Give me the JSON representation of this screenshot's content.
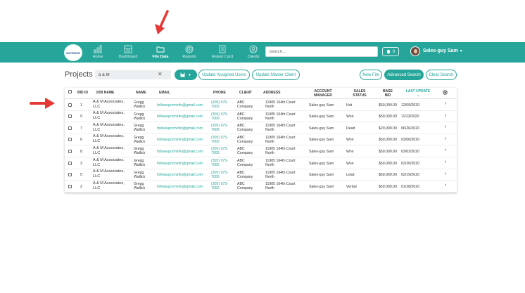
{
  "nav": {
    "logo_text": "SUPERIOR",
    "items": [
      {
        "label": "Home",
        "icon": "chart-bar-icon"
      },
      {
        "label": "Dashboard",
        "icon": "dashboard-icon"
      },
      {
        "label": "File Data",
        "icon": "folder-icon",
        "active": true
      },
      {
        "label": "Reports",
        "icon": "target-icon"
      },
      {
        "label": "Report Card",
        "icon": "card-icon"
      },
      {
        "label": "Clients",
        "icon": "clients-icon"
      }
    ],
    "search_placeholder": "Search...",
    "notification_count": "0",
    "user_name": "Sales-guy Sam"
  },
  "toolbar": {
    "title": "Projects",
    "filter_value": "a & M",
    "clear_symbol": "✕",
    "update_assigned_users": "Update Assigned Users",
    "update_master_client": "Update Master Client",
    "new_file": "New File",
    "advanced_search": "Advanced Search",
    "clear_search": "Clear Search"
  },
  "table": {
    "headers": {
      "bid_id": "BID ID",
      "job_name": "JOB NAME",
      "name": "NAME",
      "email": "EMAIL",
      "phone": "PHONE",
      "client": "CLIENT",
      "address": "ADDRESS",
      "account_manager_1": "ACCOUNT",
      "account_manager_2": "MANAGER",
      "sales_status_1": "SALES",
      "sales_status_2": "STATUS",
      "base_bid_1": "BASE",
      "base_bid_2": "BID",
      "last_update_1": "LAST UPDATE"
    },
    "rows": [
      {
        "bid_id": "1",
        "job_1": "A & M Associates,",
        "job_2": "LLC",
        "name_1": "Gregg",
        "name_2": "Wallick",
        "email": "followupcrminfo@gmail.com",
        "phone_1": "(305) 975-",
        "phone_2": "7000",
        "client_1": "ABC",
        "client_2": "Company",
        "addr_1": "11905 164th Court",
        "addr_2": "North",
        "manager": "Sales-guy Sam",
        "status": "Hot",
        "bid": "$50,000.00",
        "date": "12/09/2020"
      },
      {
        "bid_id": "9",
        "job_1": "A & M Associates,",
        "job_2": "LLC",
        "name_1": "Gregg",
        "name_2": "Wallick",
        "email": "followupcrminfo@gmail.com",
        "phone_1": "(305) 975-",
        "phone_2": "7000",
        "client_1": "ABC",
        "client_2": "Company",
        "addr_1": "11905 164th Court",
        "addr_2": "North",
        "manager": "Sales-guy Sam",
        "status": "Won",
        "bid": "$50,000.00",
        "date": "11/23/2020"
      },
      {
        "bid_id": "7",
        "job_1": "A & M Associates,",
        "job_2": "LLC",
        "name_1": "Gregg",
        "name_2": "Wallick",
        "email": "followupcrminfo@gmail.com",
        "phone_1": "(305) 975-",
        "phone_2": "7000",
        "client_1": "ABC",
        "client_2": "Company",
        "addr_1": "11905 164th Court",
        "addr_2": "North",
        "manager": "Sales-guy Sam",
        "status": "Dead",
        "bid": "$20,000.00",
        "date": "06/26/2020"
      },
      {
        "bid_id": "6",
        "job_1": "A & M Associates,",
        "job_2": "LLC",
        "name_1": "Gregg",
        "name_2": "Wallick",
        "email": "followupcrminfo@gmail.com",
        "phone_1": "(305) 975-",
        "phone_2": "7000",
        "client_1": "ABC",
        "client_2": "Company",
        "addr_1": "11905 164th Court",
        "addr_2": "North",
        "manager": "Sales-guy Sam",
        "status": "Won",
        "bid": "$50,000.00",
        "date": "03/06/2020"
      },
      {
        "bid_id": "8",
        "job_1": "A & M Associates,",
        "job_2": "LLC",
        "name_1": "Gregg",
        "name_2": "Wallick",
        "email": "followupcrminfo@gmail.com",
        "phone_1": "(305) 975-",
        "phone_2": "7000",
        "client_1": "ABC",
        "client_2": "Company",
        "addr_1": "11905 164th Court",
        "addr_2": "North",
        "manager": "Sales-guy Sam",
        "status": "Won",
        "bid": "$50,000.00",
        "date": "03/02/2020"
      },
      {
        "bid_id": "3",
        "job_1": "A & M Associates,",
        "job_2": "LLC",
        "name_1": "Gregg",
        "name_2": "Wallick",
        "email": "followupcrminfo@gmail.com",
        "phone_1": "(305) 975-",
        "phone_2": "7000",
        "client_1": "ABC",
        "client_2": "Company",
        "addr_1": "11905 164th Court",
        "addr_2": "North",
        "manager": "Sales-guy Sam",
        "status": "Won",
        "bid": "$50,000.00",
        "date": "02/20/2020"
      },
      {
        "bid_id": "5",
        "job_1": "A & M Associates,",
        "job_2": "LLC",
        "name_1": "Gregg",
        "name_2": "Wallick",
        "email": "followupcrminfo@gmail.com",
        "phone_1": "(305) 975-",
        "phone_2": "7000",
        "client_1": "ABC",
        "client_2": "Company",
        "addr_1": "11905 164th Court",
        "addr_2": "North",
        "manager": "Sales-guy Sam",
        "status": "Lead",
        "bid": "$50,000.00",
        "date": "02/19/2020"
      },
      {
        "bid_id": "2",
        "job_1": "A & M Associates,",
        "job_2": "LLC",
        "name_1": "Gregg",
        "name_2": "Wallick",
        "email": "followupcrminfo@gmail.com",
        "phone_1": "(305) 975-",
        "phone_2": "7000",
        "client_1": "ABC",
        "client_2": "Company",
        "addr_1": "11905 164th Court",
        "addr_2": "North",
        "manager": "Sales-guy Sam",
        "status": "Verbal",
        "bid": "$50,000.00",
        "date": "01/28/2020"
      }
    ]
  },
  "colors": {
    "accent": "#26a69a",
    "arrow": "#e53935"
  }
}
